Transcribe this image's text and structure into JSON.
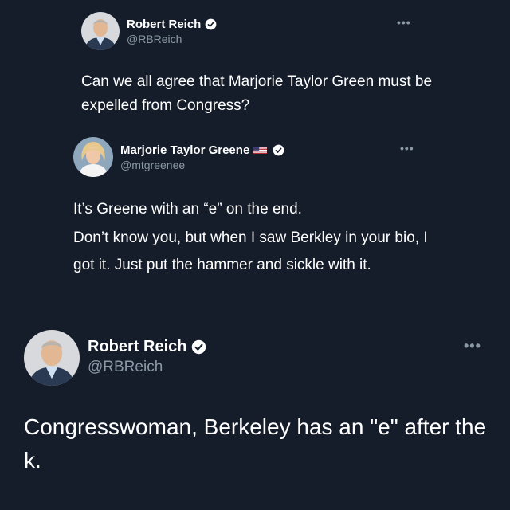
{
  "colors": {
    "background": "#151d2b",
    "text": "#ffffff",
    "secondary_text": "#8b98a5",
    "verified_badge": "#ffffff"
  },
  "tweets": [
    {
      "display_name": "Robert Reich",
      "handle": "@RBReich",
      "verified": true,
      "avatar_icon": "avatar-robert-reich",
      "more_label": "•••",
      "text": "Can we all agree that Marjorie Taylor Green must be expelled from Congress?"
    },
    {
      "display_name": "Marjorie Taylor Greene",
      "flag_icon": "us-flag-icon",
      "handle": "@mtgreenee",
      "verified": true,
      "avatar_icon": "avatar-marjorie-taylor-greene",
      "more_label": "•••",
      "paragraphs": [
        "It’s Greene with an “e” on the end.",
        "Don’t know you, but when I saw Berkley in your bio, I got it.  Just put the hammer and sickle with it."
      ]
    },
    {
      "display_name": "Robert Reich",
      "handle": "@RBReich",
      "verified": true,
      "avatar_icon": "avatar-robert-reich",
      "more_label": "•••",
      "text": "Congresswoman, Berkeley has an \"e\" after the k."
    }
  ]
}
